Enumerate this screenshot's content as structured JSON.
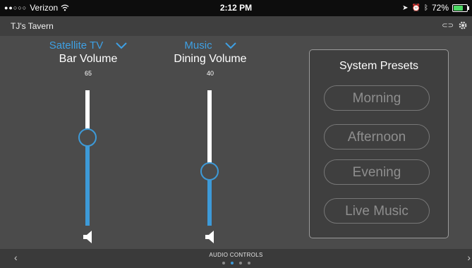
{
  "status": {
    "carrier": "Verizon",
    "time": "2:12 PM",
    "battery_pct": 0.72,
    "battery_label": "72%"
  },
  "header": {
    "title": "TJ's Tavern"
  },
  "zones": [
    {
      "source": "Satellite TV",
      "name": "Bar Volume",
      "value": "65",
      "level": 0.65
    },
    {
      "source": "Music",
      "name": "Dining Volume",
      "value": "40",
      "level": 0.4
    }
  ],
  "presets": {
    "title": "System Presets",
    "items": [
      "Morning",
      "Afternoon",
      "Evening",
      "Live Music"
    ]
  },
  "footer": {
    "label": "AUDIO CONTROLS",
    "pages": 4,
    "current_page": 2
  },
  "colors": {
    "accent": "#3d9ad8",
    "background": "#4b4b4b",
    "panel": "#3f3f3f"
  }
}
